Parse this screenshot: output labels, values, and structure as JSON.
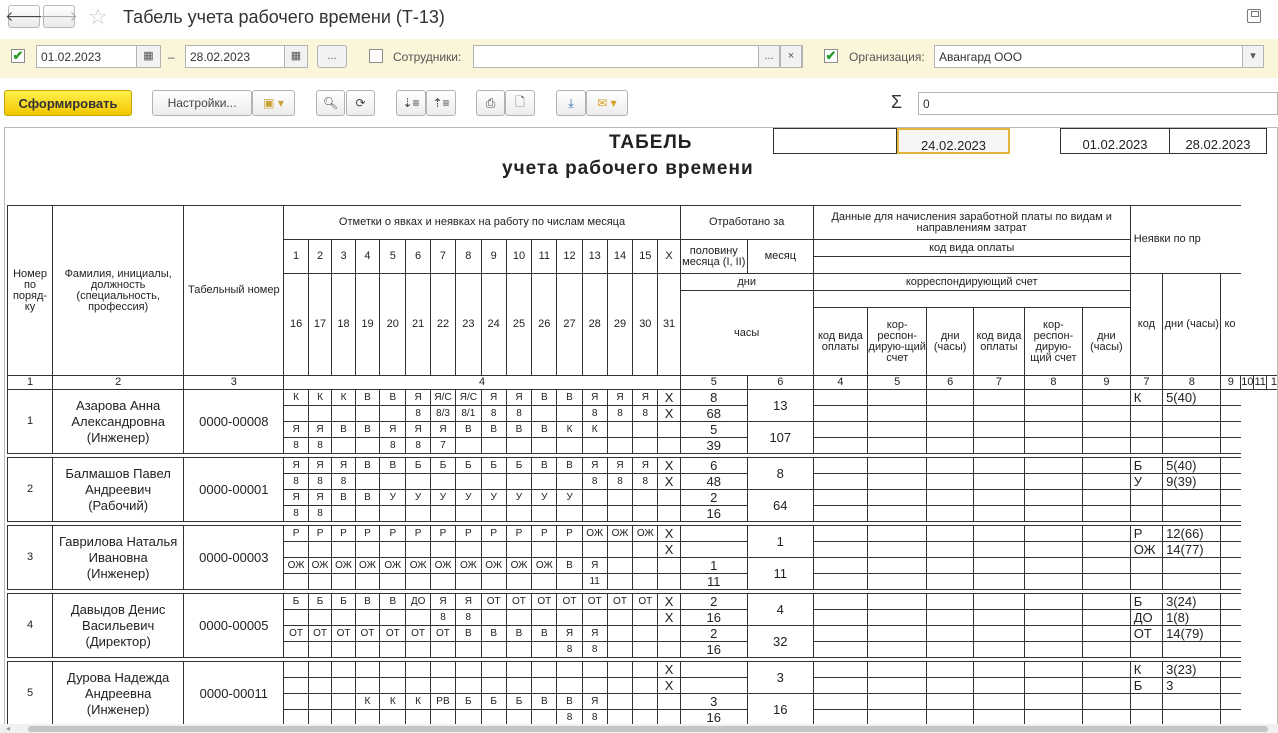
{
  "window": {
    "title": "Табель учета рабочего времени (Т-13)",
    "icons": {
      "back": "arrow-left-icon",
      "forward": "arrow-right-icon",
      "favorite": "star-icon",
      "save": "floppy-icon"
    }
  },
  "filters": {
    "period_checked": true,
    "date_from": "01.02.2023",
    "date_separator": "–",
    "date_to": "28.02.2023",
    "period_button": "...",
    "employees_checked": false,
    "employees_label": "Сотрудники:",
    "employees_value": "",
    "employees_select": "...",
    "employees_clear": "×",
    "org_checked": true,
    "org_label": "Организация:",
    "org_value": "Авангард ООО"
  },
  "toolbar": {
    "generate": "Сформировать",
    "settings": "Настройки...",
    "sum_symbol": "Σ",
    "sum_value": "0"
  },
  "report": {
    "title": "ТАБЕЛЬ",
    "subtitle": "учета  рабочего времени",
    "box_blank": "",
    "doc_date": "24.02.2023",
    "period_from": "01.02.2023",
    "period_to": "28.02.2023",
    "headers": {
      "num": "Номер по поряд-ку",
      "name": "Фамилия, инициалы, должность (специальность, профессия)",
      "tab": "Табельный номер",
      "marks": "Отметки о явках и неявках на работу по числам месяца",
      "worked": "Отработано за",
      "half": "половину месяца (I, II)",
      "month": "месяц",
      "days": "дни",
      "hours": "часы",
      "pay": "Данные для начисления заработной платы по видам и направлениям затрат",
      "paycode": "код вида оплаты",
      "corr": "корреспондирующий счет",
      "c_code": "код вида оплаты",
      "c_corr": "кор-респон-дирую-щий счет",
      "c_days": "дни (часы)",
      "absence": "Неявки по пр",
      "abs_code": "код",
      "abs_days": "дни (часы)",
      "abs_cut": "ко",
      "days_row1": [
        "1",
        "2",
        "3",
        "4",
        "5",
        "6",
        "7",
        "8",
        "9",
        "10",
        "11",
        "12",
        "13",
        "14",
        "15",
        "X"
      ],
      "days_row2": [
        "16",
        "17",
        "18",
        "19",
        "20",
        "21",
        "22",
        "23",
        "24",
        "25",
        "26",
        "27",
        "28",
        "29",
        "30",
        "31"
      ],
      "colnums": [
        "1",
        "2",
        "3",
        "4",
        "5",
        "6",
        "7",
        "8",
        "9",
        "7",
        "8",
        "9",
        "10",
        "11",
        "1"
      ]
    },
    "rows": [
      {
        "num": "1",
        "name": "Азарова Анна Александровна (Инженер)",
        "tab": "0000-00008",
        "m1": [
          "К",
          "К",
          "К",
          "В",
          "В",
          "Я",
          "Я/С",
          "Я/С",
          "Я",
          "Я",
          "В",
          "В",
          "Я",
          "Я",
          "Я",
          "X"
        ],
        "h1": [
          "",
          "",
          "",
          "",
          "",
          "8",
          "8/3",
          "8/1",
          "8",
          "8",
          "",
          "",
          "8",
          "8",
          "8",
          "X"
        ],
        "m2": [
          "Я",
          "Я",
          "В",
          "В",
          "Я",
          "Я",
          "Я",
          "В",
          "В",
          "В",
          "В",
          "К",
          "К",
          "",
          "",
          ""
        ],
        "h2": [
          "8",
          "8",
          "",
          "",
          "8",
          "8",
          "7",
          "",
          "",
          "",
          "",
          "",
          "",
          "",
          "",
          ""
        ],
        "d1": "8",
        "hr1": "68",
        "d2": "5",
        "hr2": "39",
        "md": "13",
        "mh": "107",
        "abs": [
          {
            "code": "К",
            "days": "5(40)"
          },
          {
            "code": "",
            "days": ""
          },
          {
            "code": "",
            "days": ""
          },
          {
            "code": "",
            "days": ""
          }
        ]
      },
      {
        "num": "2",
        "name": "Балмашов Павел Андреевич (Рабочий)",
        "tab": "0000-00001",
        "m1": [
          "Я",
          "Я",
          "Я",
          "В",
          "В",
          "Б",
          "Б",
          "Б",
          "Б",
          "Б",
          "В",
          "В",
          "Я",
          "Я",
          "Я",
          "X"
        ],
        "h1": [
          "8",
          "8",
          "8",
          "",
          "",
          "",
          "",
          "",
          "",
          "",
          "",
          "",
          "8",
          "8",
          "8",
          "X"
        ],
        "m2": [
          "Я",
          "Я",
          "В",
          "В",
          "У",
          "У",
          "У",
          "У",
          "У",
          "У",
          "У",
          "У",
          "",
          "",
          "",
          ""
        ],
        "h2": [
          "8",
          "8",
          "",
          "",
          "",
          "",
          "",
          "",
          "",
          "",
          "",
          "",
          "",
          "",
          "",
          ""
        ],
        "d1": "6",
        "hr1": "48",
        "d2": "2",
        "hr2": "16",
        "md": "8",
        "mh": "64",
        "abs": [
          {
            "code": "Б",
            "days": "5(40)"
          },
          {
            "code": "У",
            "days": "9(39)"
          },
          {
            "code": "",
            "days": ""
          },
          {
            "code": "",
            "days": ""
          }
        ]
      },
      {
        "num": "3",
        "name": "Гаврилова Наталья Ивановна (Инженер)",
        "tab": "0000-00003",
        "m1": [
          "Р",
          "Р",
          "Р",
          "Р",
          "Р",
          "Р",
          "Р",
          "Р",
          "Р",
          "Р",
          "Р",
          "Р",
          "ОЖ",
          "ОЖ",
          "ОЖ",
          "X"
        ],
        "h1": [
          "",
          "",
          "",
          "",
          "",
          "",
          "",
          "",
          "",
          "",
          "",
          "",
          "",
          "",
          "",
          "X"
        ],
        "m2": [
          "ОЖ",
          "ОЖ",
          "ОЖ",
          "ОЖ",
          "ОЖ",
          "ОЖ",
          "ОЖ",
          "ОЖ",
          "ОЖ",
          "ОЖ",
          "ОЖ",
          "В",
          "Я",
          "",
          "",
          ""
        ],
        "h2": [
          "",
          "",
          "",
          "",
          "",
          "",
          "",
          "",
          "",
          "",
          "",
          "",
          "11",
          "",
          "",
          ""
        ],
        "d1": "",
        "hr1": "",
        "d2": "1",
        "hr2": "11",
        "md": "1",
        "mh": "11",
        "abs": [
          {
            "code": "Р",
            "days": "12(66)"
          },
          {
            "code": "ОЖ",
            "days": "14(77)"
          },
          {
            "code": "",
            "days": ""
          },
          {
            "code": "",
            "days": ""
          }
        ]
      },
      {
        "num": "4",
        "name": "Давыдов Денис Васильевич (Директор)",
        "tab": "0000-00005",
        "m1": [
          "Б",
          "Б",
          "Б",
          "В",
          "В",
          "ДО",
          "Я",
          "Я",
          "ОТ",
          "ОТ",
          "ОТ",
          "ОТ",
          "ОТ",
          "ОТ",
          "ОТ",
          "X"
        ],
        "h1": [
          "",
          "",
          "",
          "",
          "",
          "",
          "8",
          "8",
          "",
          "",
          "",
          "",
          "",
          "",
          "",
          "X"
        ],
        "m2": [
          "ОТ",
          "ОТ",
          "ОТ",
          "ОТ",
          "ОТ",
          "ОТ",
          "ОТ",
          "В",
          "В",
          "В",
          "В",
          "Я",
          "Я",
          "",
          "",
          ""
        ],
        "h2": [
          "",
          "",
          "",
          "",
          "",
          "",
          "",
          "",
          "",
          "",
          "",
          "8",
          "8",
          "",
          "",
          ""
        ],
        "d1": "2",
        "hr1": "16",
        "d2": "2",
        "hr2": "16",
        "md": "4",
        "mh": "32",
        "abs": [
          {
            "code": "Б",
            "days": "3(24)"
          },
          {
            "code": "ДО",
            "days": "1(8)"
          },
          {
            "code": "ОТ",
            "days": "14(79)"
          },
          {
            "code": "",
            "days": ""
          }
        ]
      },
      {
        "num": "5",
        "name": "Дурова Надежда Андреевна (Инженер)",
        "tab": "0000-00011",
        "m1": [
          "",
          "",
          "",
          "",
          "",
          "",
          "",
          "",
          "",
          "",
          "",
          "",
          "",
          "",
          "",
          "X"
        ],
        "h1": [
          "",
          "",
          "",
          "",
          "",
          "",
          "",
          "",
          "",
          "",
          "",
          "",
          "",
          "",
          "",
          "X"
        ],
        "m2": [
          "",
          "",
          "",
          "К",
          "К",
          "К",
          "РВ",
          "Б",
          "Б",
          "Б",
          "В",
          "В",
          "Я",
          "",
          "",
          ""
        ],
        "h2": [
          "",
          "",
          "",
          "",
          "",
          "",
          "",
          "",
          "",
          "",
          "",
          "8",
          "8",
          "",
          "",
          ""
        ],
        "d1": "",
        "hr1": "",
        "d2": "3",
        "hr2": "16",
        "md": "3",
        "mh": "16",
        "abs": [
          {
            "code": "К",
            "days": "3(23)"
          },
          {
            "code": "Б",
            "days": "3"
          },
          {
            "code": "",
            "days": ""
          },
          {
            "code": "",
            "days": ""
          }
        ]
      }
    ]
  }
}
